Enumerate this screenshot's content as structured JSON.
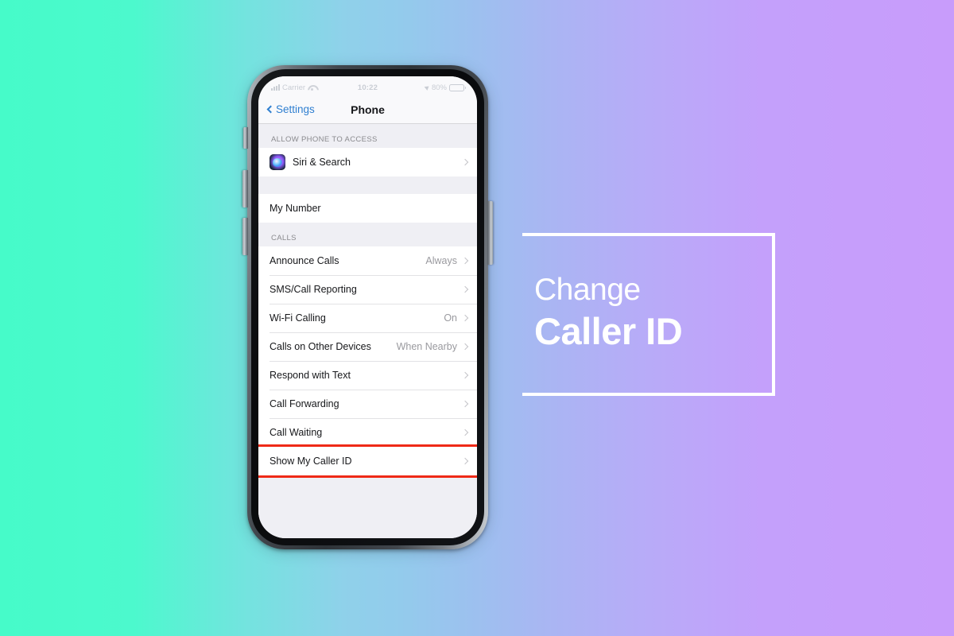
{
  "background": {
    "gradient_start": "#46FBC9",
    "gradient_mid": "#93CBEC",
    "gradient_end": "#C89CFB"
  },
  "promo": {
    "line1": "Change",
    "line2": "Caller ID",
    "frame_color": "#FFFFFF"
  },
  "phone": {
    "status_bar": {
      "carrier": "Carrier",
      "time": "10:22",
      "battery_percent": "80%",
      "signal_icon": "signal-bars-icon",
      "wifi_icon": "wifi-icon",
      "location_icon": "location-arrow-icon",
      "battery_icon": "battery-icon"
    },
    "nav": {
      "back_label": "Settings",
      "title": "Phone",
      "back_icon": "chevron-left-icon",
      "back_color": "#2F7FD0"
    },
    "sections": [
      {
        "header": "ALLOW PHONE TO ACCESS",
        "rows": [
          {
            "label": "Siri & Search",
            "value": "",
            "icon": "siri-icon",
            "accessory": "chevron-right-icon",
            "highlighted": false
          }
        ]
      },
      {
        "header": "",
        "rows": [
          {
            "label": "My Number",
            "value": "",
            "icon": "",
            "accessory": "",
            "highlighted": false
          }
        ]
      },
      {
        "header": "CALLS",
        "rows": [
          {
            "label": "Announce Calls",
            "value": "Always",
            "icon": "",
            "accessory": "chevron-right-icon",
            "highlighted": false
          },
          {
            "label": "SMS/Call Reporting",
            "value": "",
            "icon": "",
            "accessory": "chevron-right-icon",
            "highlighted": false
          },
          {
            "label": "Wi-Fi Calling",
            "value": "On",
            "icon": "",
            "accessory": "chevron-right-icon",
            "highlighted": false
          },
          {
            "label": "Calls on Other Devices",
            "value": "When Nearby",
            "icon": "",
            "accessory": "chevron-right-icon",
            "highlighted": false
          },
          {
            "label": "Respond with Text",
            "value": "",
            "icon": "",
            "accessory": "chevron-right-icon",
            "highlighted": false
          },
          {
            "label": "Call Forwarding",
            "value": "",
            "icon": "",
            "accessory": "chevron-right-icon",
            "highlighted": false
          },
          {
            "label": "Call Waiting",
            "value": "",
            "icon": "",
            "accessory": "chevron-right-icon",
            "highlighted": false
          },
          {
            "label": "Show My Caller ID",
            "value": "",
            "icon": "",
            "accessory": "chevron-right-icon",
            "highlighted": true
          }
        ]
      }
    ],
    "highlight_color": "#EF2A17",
    "home_indicator": "home-indicator"
  }
}
